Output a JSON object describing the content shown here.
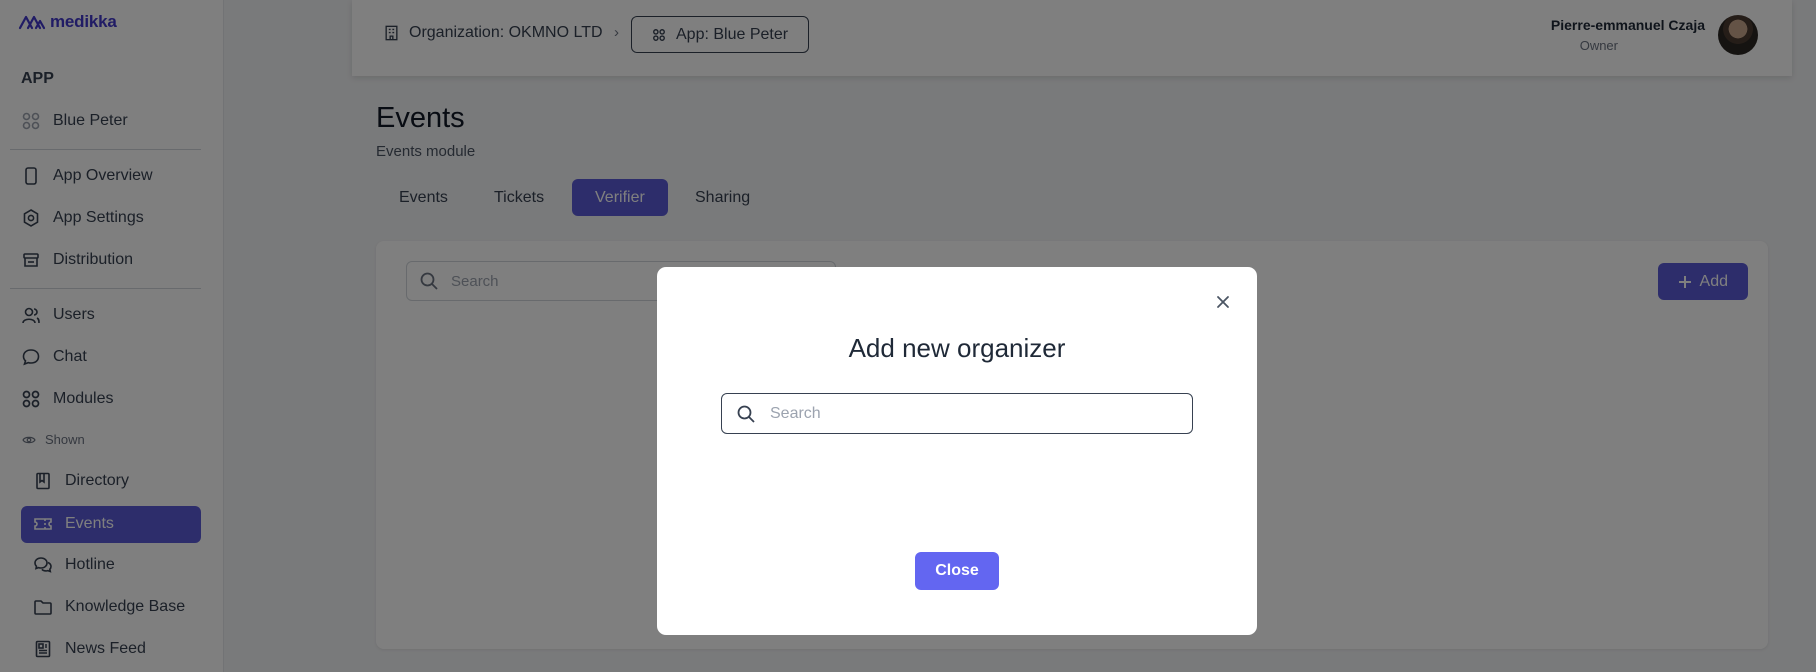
{
  "logo": {
    "text": "medikka"
  },
  "sidebar": {
    "section_title": "APP",
    "app_name": "Blue Peter",
    "items_main": [
      {
        "label": "App Overview",
        "icon": "phone-icon"
      },
      {
        "label": "App Settings",
        "icon": "gear-icon"
      },
      {
        "label": "Distribution",
        "icon": "store-icon"
      }
    ],
    "items_secondary": [
      {
        "label": "Users",
        "icon": "users-icon"
      },
      {
        "label": "Chat",
        "icon": "chat-icon"
      },
      {
        "label": "Modules",
        "icon": "modules-icon"
      }
    ],
    "shown_label": "Shown",
    "modules": [
      {
        "label": "Directory",
        "icon": "book-icon"
      },
      {
        "label": "Events",
        "icon": "ticket-icon",
        "active": true
      },
      {
        "label": "Hotline",
        "icon": "chats-icon"
      },
      {
        "label": "Knowledge Base",
        "icon": "folder-icon"
      },
      {
        "label": "News Feed",
        "icon": "newspaper-icon"
      }
    ]
  },
  "topbar": {
    "org_crumb": "Organization: OKMNO LTD",
    "separator": "›",
    "app_crumb": "App: Blue Peter",
    "user_name": "Pierre-emmanuel Czaja",
    "user_role": "Owner"
  },
  "main": {
    "title": "Events",
    "subtitle": "Events module",
    "tabs": [
      {
        "label": "Events"
      },
      {
        "label": "Tickets"
      },
      {
        "label": "Verifier",
        "active": true
      },
      {
        "label": "Sharing"
      }
    ],
    "search_placeholder": "Search",
    "add_label": "Add"
  },
  "modal": {
    "title": "Add new organizer",
    "search_placeholder": "Search",
    "close_label": "Close"
  },
  "colors": {
    "accent": "#5b5bd6",
    "button": "#6366f1",
    "logo": "#4338ca"
  }
}
